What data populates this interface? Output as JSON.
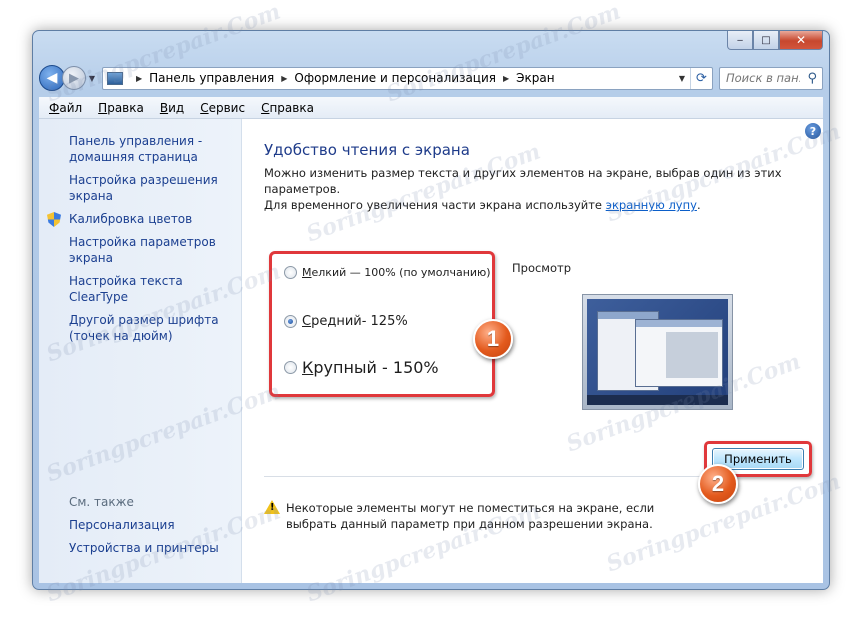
{
  "window": {
    "minimize_label": "‒",
    "maximize_label": "□",
    "close_label": "✕"
  },
  "address_bar": {
    "breadcrumbs": [
      "Панель управления",
      "Оформление и персонализация",
      "Экран"
    ]
  },
  "search": {
    "placeholder": "Поиск в пан..."
  },
  "menu": [
    "Файл",
    "Правка",
    "Вид",
    "Сервис",
    "Справка"
  ],
  "sidebar": {
    "links": [
      "Панель управления - домашняя страница",
      "Настройка разрешения экрана",
      "Калибровка цветов",
      "Настройка параметров экрана",
      "Настройка текста ClearType",
      "Другой размер шрифта (точек на дюйм)"
    ],
    "see_also_title": "См. также",
    "see_also_links": [
      "Персонализация",
      "Устройства и принтеры"
    ]
  },
  "main": {
    "title": "Удобство чтения с экрана",
    "description_line1": "Можно изменить размер текста и других элементов на экране, выбрав один из этих параметров.",
    "description_line2_prefix": "Для временного увеличения части экрана используйте ",
    "magnifier_link": "экранную лупу",
    "description_line2_suffix": ".",
    "options": [
      {
        "label": "Мелкий — 100% (по умолчанию)",
        "checked": false
      },
      {
        "label": "Средний- 125%",
        "checked": true
      },
      {
        "label": "Крупный - 150%",
        "checked": false
      }
    ],
    "preview_label": "Просмотр",
    "warning": "Некоторые элементы могут не поместиться на экране, если выбрать данный параметр при данном разрешении экрана.",
    "apply_button": "Применить",
    "help": "?"
  },
  "annotations": {
    "badge1": "1",
    "badge2": "2"
  },
  "watermark": "Soringpcrepair.Com"
}
